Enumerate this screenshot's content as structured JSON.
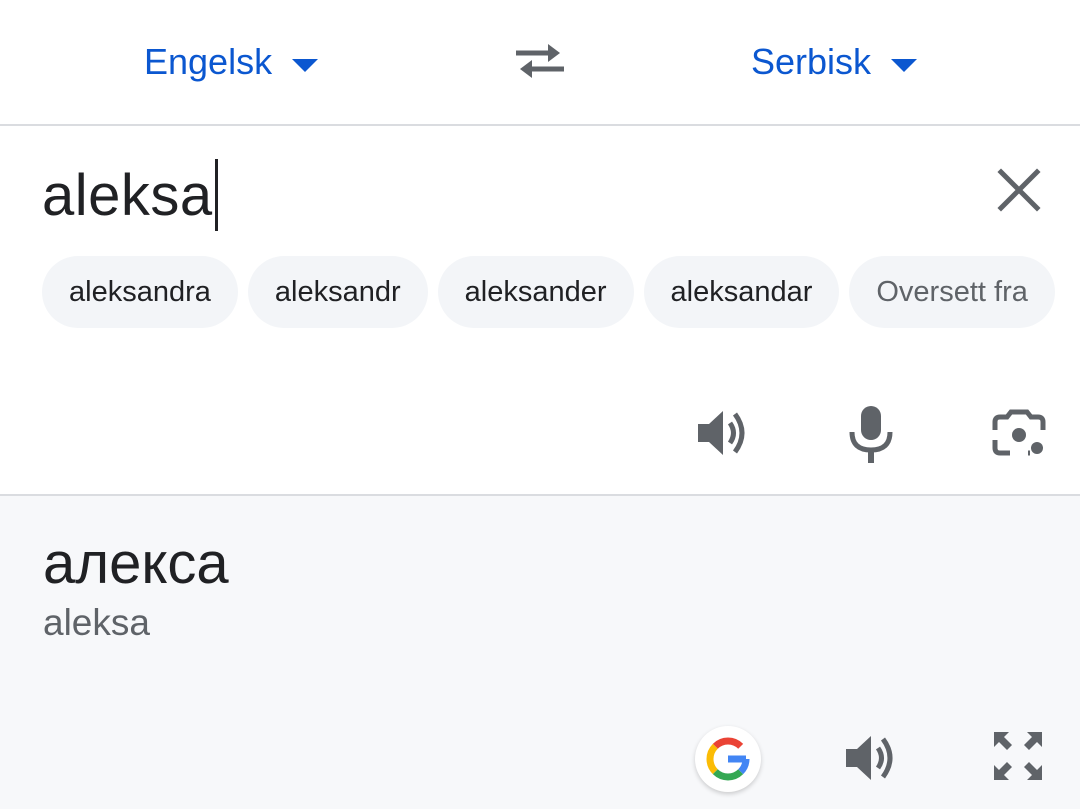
{
  "languages": {
    "source": "Engelsk",
    "target": "Serbisk"
  },
  "input": {
    "text": "aleksa"
  },
  "suggestions": [
    "aleksandra",
    "aleksandr",
    "aleksander",
    "aleksandar",
    "Oversett fra"
  ],
  "output": {
    "translation": "алекса",
    "transliteration": "aleksa"
  },
  "icons": {
    "swap": "swap-arrows-icon",
    "clear": "close-icon",
    "speak": "volume-icon",
    "mic": "microphone-icon",
    "camera": "camera-icon",
    "google": "google-g-icon",
    "fullscreen": "fullscreen-icon"
  },
  "colors": {
    "accent": "#0b57d0",
    "icon": "#5f6368",
    "output_bg": "#f7f8fa"
  }
}
